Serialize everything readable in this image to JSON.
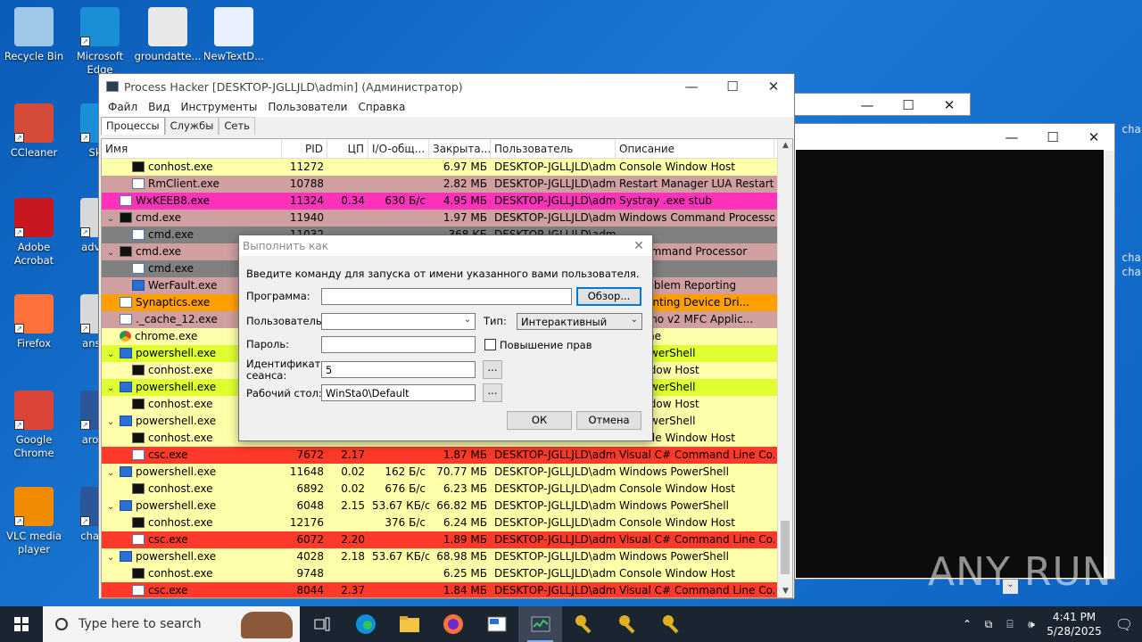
{
  "desktop_icons": [
    {
      "label": "Recycle Bin"
    },
    {
      "label": "Microsoft Edge"
    },
    {
      "label": "groundatte..."
    },
    {
      "label": "NewTextD..."
    },
    {
      "label": "CCleaner"
    },
    {
      "label": "Sk..."
    },
    {
      "label": "Adobe Acrobat"
    },
    {
      "label": "advic..."
    },
    {
      "label": "Firefox"
    },
    {
      "label": "answ..."
    },
    {
      "label": "Google Chrome"
    },
    {
      "label": "arour..."
    },
    {
      "label": "VLC media player"
    },
    {
      "label": "charg..."
    }
  ],
  "side_text": [
    "cha",
    "cha",
    "cha"
  ],
  "window": {
    "title": "Process Hacker [DESKTOP-JGLLJLD\\admin] (Администратор)",
    "controls": [
      "—",
      "☐",
      "✕"
    ]
  },
  "menu": [
    "Файл",
    "Вид",
    "Инструменты",
    "Пользователи",
    "Справка"
  ],
  "tabs": [
    "Процессы",
    "Службы",
    "Сеть"
  ],
  "columns": [
    "Имя",
    "PID",
    "ЦП",
    "I/O-общ...",
    "Закрыта...",
    "Пользователь",
    "Описание"
  ],
  "rows": [
    {
      "indent": 2,
      "chev": "",
      "icon": "cmd",
      "name": "conhost.exe",
      "pid": "11272",
      "cpu": "",
      "io": "",
      "mem": "6.97 МБ",
      "user": "DESKTOP-JGLLJLD\\admi",
      "desc": "Console Window Host",
      "bg": "#ffffaa"
    },
    {
      "indent": 2,
      "chev": "",
      "icon": "cs",
      "name": "RmClient.exe",
      "pid": "10788",
      "cpu": "",
      "io": "",
      "mem": "2.82 МБ",
      "user": "DESKTOP-JGLLJLD\\admi",
      "desc": "Restart Manager LUA Restart ...",
      "bg": "#d0a0a0"
    },
    {
      "indent": 1,
      "chev": "",
      "icon": "cs",
      "name": "WxKEEB8.exe",
      "pid": "11324",
      "cpu": "0.34",
      "io": "630 Б/с",
      "mem": "4.95 МБ",
      "user": "DESKTOP-JGLLJLD\\admi",
      "desc": "Systray .exe stub",
      "bg": "#ff33bb"
    },
    {
      "indent": 1,
      "chev": "⌄",
      "icon": "cmd",
      "name": "cmd.exe",
      "pid": "11940",
      "cpu": "",
      "io": "",
      "mem": "1.97 МБ",
      "user": "DESKTOP-JGLLJLD\\admi",
      "desc": "Windows Command Processor",
      "bg": "#d0a0a0"
    },
    {
      "indent": 2,
      "chev": "",
      "icon": "cs",
      "name": "cmd.exe",
      "pid": "11032",
      "cpu": "",
      "io": "",
      "mem": "368 КБ",
      "user": "DESKTOP-JGLLJLD\\admi",
      "desc": "",
      "bg": "#808080"
    },
    {
      "indent": 1,
      "chev": "⌄",
      "icon": "cmd",
      "name": "cmd.exe",
      "pid": "",
      "cpu": "",
      "io": "",
      "mem": "",
      "user": "",
      "desc": "ws Command Processor",
      "bg": "#d0a0a0"
    },
    {
      "indent": 2,
      "chev": "",
      "icon": "cs",
      "name": "cmd.exe",
      "pid": "",
      "cpu": "",
      "io": "",
      "mem": "",
      "user": "",
      "desc": "",
      "bg": "#808080"
    },
    {
      "indent": 2,
      "chev": "",
      "icon": "ps",
      "name": "WerFault.exe",
      "pid": "",
      "cpu": "",
      "io": "",
      "mem": "",
      "user": "",
      "desc": "ws Problem Reporting",
      "bg": "#d0a0a0"
    },
    {
      "indent": 1,
      "chev": "",
      "icon": "cs",
      "name": "Synaptics.exe",
      "pid": "",
      "cpu": "",
      "io": "",
      "mem": "",
      "user": "",
      "desc": "ics Pointing Device Dri...",
      "bg": "#ffa000"
    },
    {
      "indent": 1,
      "chev": "",
      "icon": "cs",
      "name": "._cache_12.exe",
      "pid": "",
      "cpu": "",
      "io": "",
      "mem": "",
      "user": "",
      "desc": "evDemo v2 MFC Applic...",
      "bg": "#d0a0a0"
    },
    {
      "indent": 1,
      "chev": "",
      "icon": "chr",
      "name": "chrome.exe",
      "pid": "",
      "cpu": "",
      "io": "",
      "mem": "",
      "user": "",
      "desc": "Chrome",
      "bg": "#ffffaa"
    },
    {
      "indent": 1,
      "chev": "⌄",
      "icon": "ps",
      "name": "powershell.exe",
      "pid": "",
      "cpu": "",
      "io": "",
      "mem": "",
      "user": "",
      "desc": "ws PowerShell",
      "bg": "#e0ff30"
    },
    {
      "indent": 2,
      "chev": "",
      "icon": "cmd",
      "name": "conhost.exe",
      "pid": "",
      "cpu": "",
      "io": "",
      "mem": "",
      "user": "",
      "desc": "e Window Host",
      "bg": "#ffffaa"
    },
    {
      "indent": 1,
      "chev": "⌄",
      "icon": "ps",
      "name": "powershell.exe",
      "pid": "",
      "cpu": "",
      "io": "",
      "mem": "",
      "user": "",
      "desc": "ws PowerShell",
      "bg": "#e0ff30"
    },
    {
      "indent": 2,
      "chev": "",
      "icon": "cmd",
      "name": "conhost.exe",
      "pid": "",
      "cpu": "",
      "io": "",
      "mem": "",
      "user": "",
      "desc": "e Window Host",
      "bg": "#ffffaa"
    },
    {
      "indent": 1,
      "chev": "⌄",
      "icon": "ps",
      "name": "powershell.exe",
      "pid": "",
      "cpu": "",
      "io": "",
      "mem": "",
      "user": "",
      "desc": "ws PowerShell",
      "bg": "#ffffaa"
    },
    {
      "indent": 2,
      "chev": "",
      "icon": "cmd",
      "name": "conhost.exe",
      "pid": "",
      "cpu": "",
      "io": "",
      "mem": "",
      "user": "",
      "desc": "Console Window Host",
      "bg": "#ffffaa"
    },
    {
      "indent": 2,
      "chev": "",
      "icon": "cs",
      "name": "csc.exe",
      "pid": "7672",
      "cpu": "2.17",
      "io": "",
      "mem": "1.87 МБ",
      "user": "DESKTOP-JGLLJLD\\admi",
      "desc": "Visual C# Command Line Co...",
      "bg": "#ff3a2a"
    },
    {
      "indent": 1,
      "chev": "⌄",
      "icon": "ps",
      "name": "powershell.exe",
      "pid": "11648",
      "cpu": "0.02",
      "io": "162 Б/с",
      "mem": "70.77 МБ",
      "user": "DESKTOP-JGLLJLD\\admi",
      "desc": "Windows PowerShell",
      "bg": "#ffffaa"
    },
    {
      "indent": 2,
      "chev": "",
      "icon": "cmd",
      "name": "conhost.exe",
      "pid": "6892",
      "cpu": "0.02",
      "io": "676 Б/с",
      "mem": "6.23 МБ",
      "user": "DESKTOP-JGLLJLD\\admi",
      "desc": "Console Window Host",
      "bg": "#ffffaa"
    },
    {
      "indent": 1,
      "chev": "⌄",
      "icon": "ps",
      "name": "powershell.exe",
      "pid": "6048",
      "cpu": "2.15",
      "io": "53.67 КБ/с",
      "mem": "66.82 МБ",
      "user": "DESKTOP-JGLLJLD\\admi",
      "desc": "Windows PowerShell",
      "bg": "#ffffaa"
    },
    {
      "indent": 2,
      "chev": "",
      "icon": "cmd",
      "name": "conhost.exe",
      "pid": "12176",
      "cpu": "",
      "io": "376 Б/с",
      "mem": "6.24 МБ",
      "user": "DESKTOP-JGLLJLD\\admi",
      "desc": "Console Window Host",
      "bg": "#ffffaa"
    },
    {
      "indent": 2,
      "chev": "",
      "icon": "cs",
      "name": "csc.exe",
      "pid": "6072",
      "cpu": "2.20",
      "io": "",
      "mem": "1.89 МБ",
      "user": "DESKTOP-JGLLJLD\\admi",
      "desc": "Visual C# Command Line Co...",
      "bg": "#ff3a2a"
    },
    {
      "indent": 1,
      "chev": "⌄",
      "icon": "ps",
      "name": "powershell.exe",
      "pid": "4028",
      "cpu": "2.18",
      "io": "53.67 КБ/с",
      "mem": "68.98 МБ",
      "user": "DESKTOP-JGLLJLD\\admi",
      "desc": "Windows PowerShell",
      "bg": "#ffffaa"
    },
    {
      "indent": 2,
      "chev": "",
      "icon": "cmd",
      "name": "conhost.exe",
      "pid": "9748",
      "cpu": "",
      "io": "",
      "mem": "6.25 МБ",
      "user": "DESKTOP-JGLLJLD\\admi",
      "desc": "Console Window Host",
      "bg": "#ffffaa"
    },
    {
      "indent": 2,
      "chev": "",
      "icon": "cs",
      "name": "csc.exe",
      "pid": "8044",
      "cpu": "2.37",
      "io": "",
      "mem": "1.84 МБ",
      "user": "DESKTOP-JGLLJLD\\admi",
      "desc": "Visual C# Command Line Co...",
      "bg": "#ff3a2a"
    }
  ],
  "dialog": {
    "title": "Выполнить как",
    "instruction": "Введите команду для запуска от имени указанного вами пользователя.",
    "program_label": "Программа:",
    "program_value": "",
    "browse_label": "Обзор...",
    "user_label": "Пользователь:",
    "user_value": "",
    "type_label": "Тип:",
    "type_value": "Интерактивный",
    "password_label": "Пароль:",
    "password_value": "",
    "elevate_label": "Повышение прав",
    "session_label_1": "Идентификатор",
    "session_label_2": "сеанса:",
    "session_value": "5",
    "desktop_label": "Рабочий стол:",
    "desktop_value": "WinSta0\\Default",
    "ellipsis": "...",
    "ok_label": "ОК",
    "cancel_label": "Отмена"
  },
  "watermark": "ANY RUN",
  "taskbar": {
    "search_placeholder": "Type here to search",
    "time": "4:41 PM",
    "date": "5/28/2025"
  }
}
